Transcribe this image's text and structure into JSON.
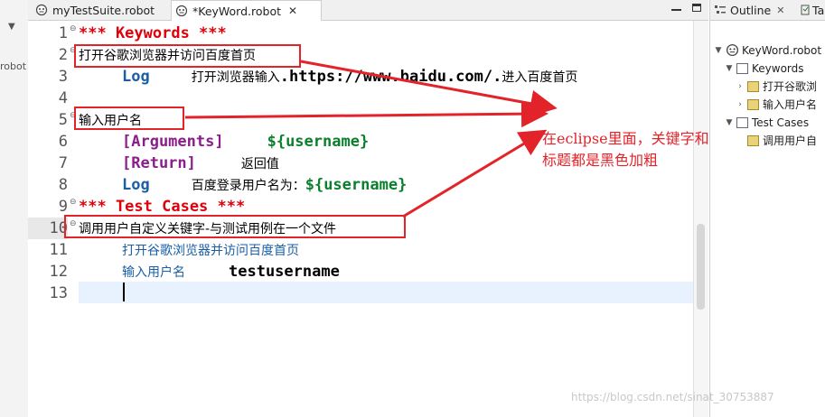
{
  "left_panel": {
    "label": "robot"
  },
  "tabs": [
    {
      "label": "myTestSuite.robot"
    },
    {
      "label": "*KeyWord.robot",
      "close": "✕"
    }
  ],
  "editor": {
    "line_numbers": [
      "1",
      "2",
      "3",
      "4",
      "5",
      "6",
      "7",
      "8",
      "9",
      "10",
      "11",
      "12",
      "13"
    ],
    "lines": {
      "l1": "*** Keywords ***",
      "l2": "打开谷歌浏览器并访问百度首页",
      "l3_kw": "Log",
      "l3_a": "打开浏览器输入",
      "l3_b": ".https://www.baidu.com/.",
      "l3_c": "进入百度首页",
      "l5": "输入用户名",
      "l6_kw": "[Arguments]",
      "l6_var": "${username}",
      "l7_kw": "[Return]",
      "l7_txt": "返回值",
      "l8_kw": "Log",
      "l8_txt": "百度登录用户名为：",
      "l8_var": "${username}",
      "l9": "*** Test Cases ***",
      "l10": "调用用户自定义关键字-与测试用例在一个文件",
      "l11": "打开谷歌浏览器并访问百度首页",
      "l12_a": "输入用户名",
      "l12_b": "testusername"
    }
  },
  "annotation": {
    "line1": "在eclipse里面，关键字和用例",
    "line2": "标题都是黑色加粗"
  },
  "outline": {
    "tab_label": "Outline",
    "tab2_label": "Ta",
    "items": [
      {
        "label": "KeyWord.robot"
      },
      {
        "label": "Keywords"
      },
      {
        "label": "打开谷歌浏"
      },
      {
        "label": "输入用户名"
      },
      {
        "label": "Test Cases"
      },
      {
        "label": "调用用户自"
      }
    ]
  },
  "watermark": "https://blog.csdn.net/sinat_30753887",
  "colors": {
    "annotation": "#e3232a",
    "keyword_header": "#e0000a",
    "builtin": "#1a5fa6",
    "setting": "#8b1e8b",
    "variable": "#0b7f2c"
  }
}
